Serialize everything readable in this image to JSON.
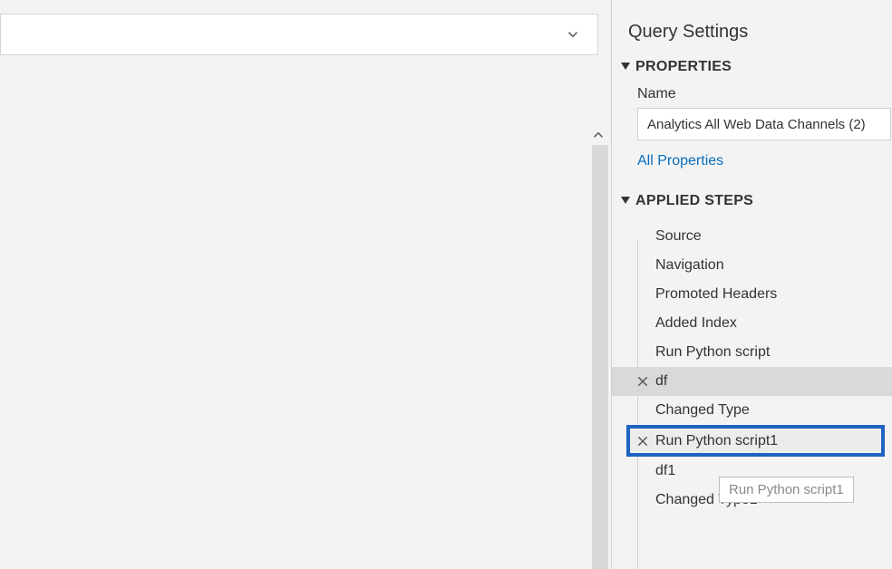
{
  "panel": {
    "title": "Query Settings"
  },
  "properties": {
    "section_label": "PROPERTIES",
    "name_label": "Name",
    "name_value": "Analytics All Web Data Channels (2)",
    "all_properties_link": "All Properties"
  },
  "applied_steps": {
    "section_label": "APPLIED STEPS",
    "steps": [
      {
        "label": "Source"
      },
      {
        "label": "Navigation"
      },
      {
        "label": "Promoted Headers"
      },
      {
        "label": "Added Index"
      },
      {
        "label": "Run Python script"
      },
      {
        "label": "df",
        "hovered": true,
        "show_delete": true
      },
      {
        "label": "Changed Type"
      },
      {
        "label": "Run Python script1",
        "highlighted": true,
        "show_delete": true
      },
      {
        "label": "df1"
      },
      {
        "label": "Changed Type1"
      }
    ],
    "tooltip": "Run Python script1"
  }
}
